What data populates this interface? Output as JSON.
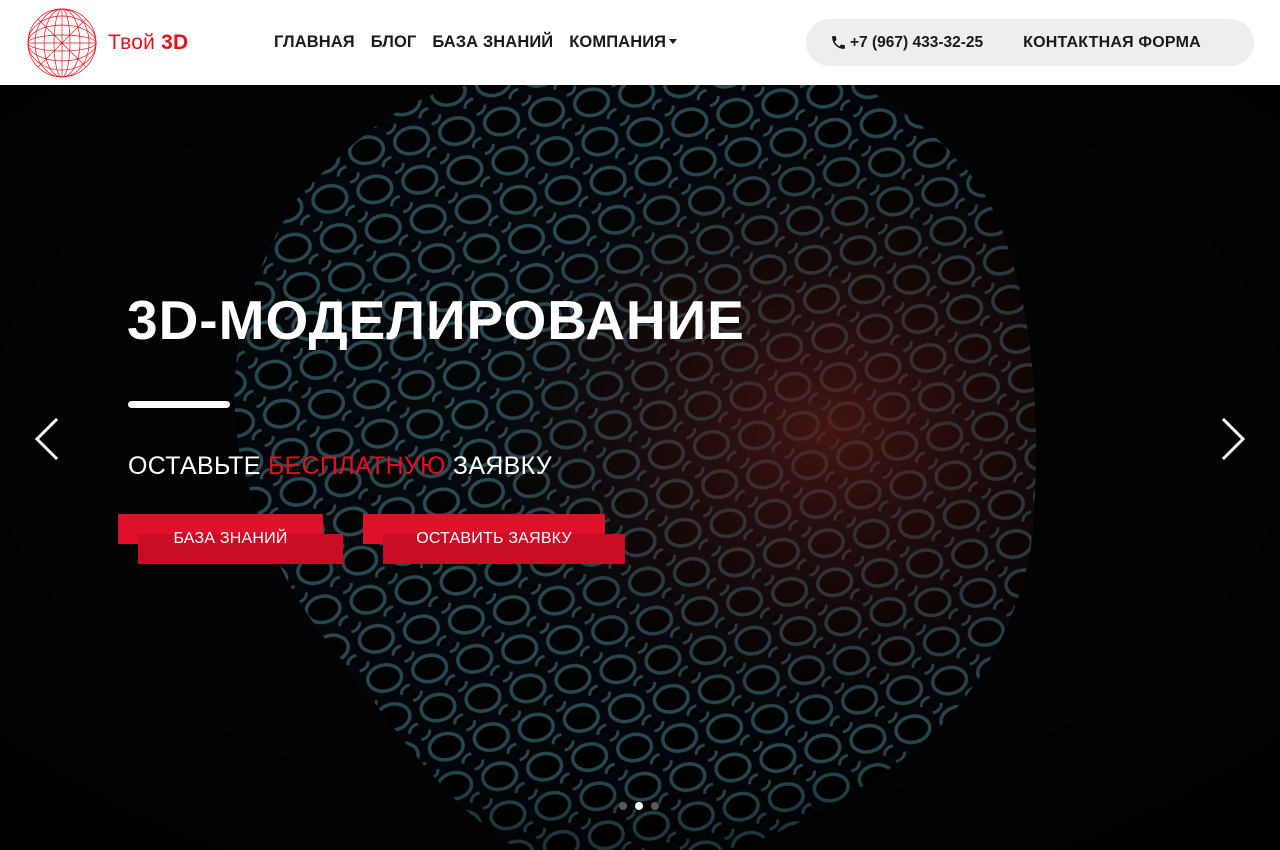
{
  "brand": {
    "name_light": "Твой",
    "name_bold": "3D",
    "logo_icon": "wireframe-sphere-icon",
    "accent_color": "#e3101d"
  },
  "nav": {
    "items": [
      {
        "label": "ГЛАВНАЯ"
      },
      {
        "label": "БЛОГ"
      },
      {
        "label": "БАЗА ЗНАНИЙ"
      },
      {
        "label": "КОМПАНИЯ",
        "has_dropdown": true
      }
    ]
  },
  "contact": {
    "phone_icon": "phone-icon",
    "phone": "+7 (967) 433-32-25",
    "form_label": "КОНТАКТНАЯ ФОРМА"
  },
  "hero": {
    "title": "3D-МОДЕЛИРОВАНИЕ",
    "subtitle_before": "ОСТАВЬТЕ ",
    "subtitle_accent": "БЕСПЛАТНУЮ",
    "subtitle_after": " ЗАЯВКУ",
    "buttons": [
      {
        "label": "БАЗА ЗНАНИЙ"
      },
      {
        "label": "ОСТАВИТЬ ЗАЯВКУ"
      }
    ],
    "prev_icon": "chevron-left-icon",
    "next_icon": "chevron-right-icon",
    "slides_total": 3,
    "active_slide": 2
  }
}
